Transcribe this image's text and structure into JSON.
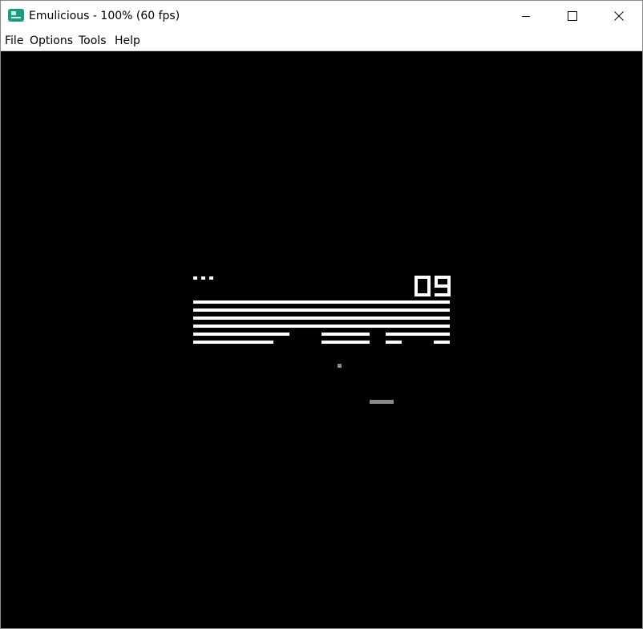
{
  "window": {
    "title": "Emulicious - 100% (60 fps)",
    "icon": "emulicious-app-icon"
  },
  "controls": {
    "minimize_icon": "minimize-icon",
    "maximize_icon": "maximize-icon",
    "close_icon": "close-icon"
  },
  "menu": {
    "file": "File",
    "options": "Options",
    "tools": "Tools",
    "help": "Help"
  },
  "game": {
    "score": "09",
    "lives_indicator": "...",
    "colors": {
      "background": "#000000",
      "bricks": "#ffffff",
      "ball_and_paddle": "#8a8a8a"
    }
  }
}
